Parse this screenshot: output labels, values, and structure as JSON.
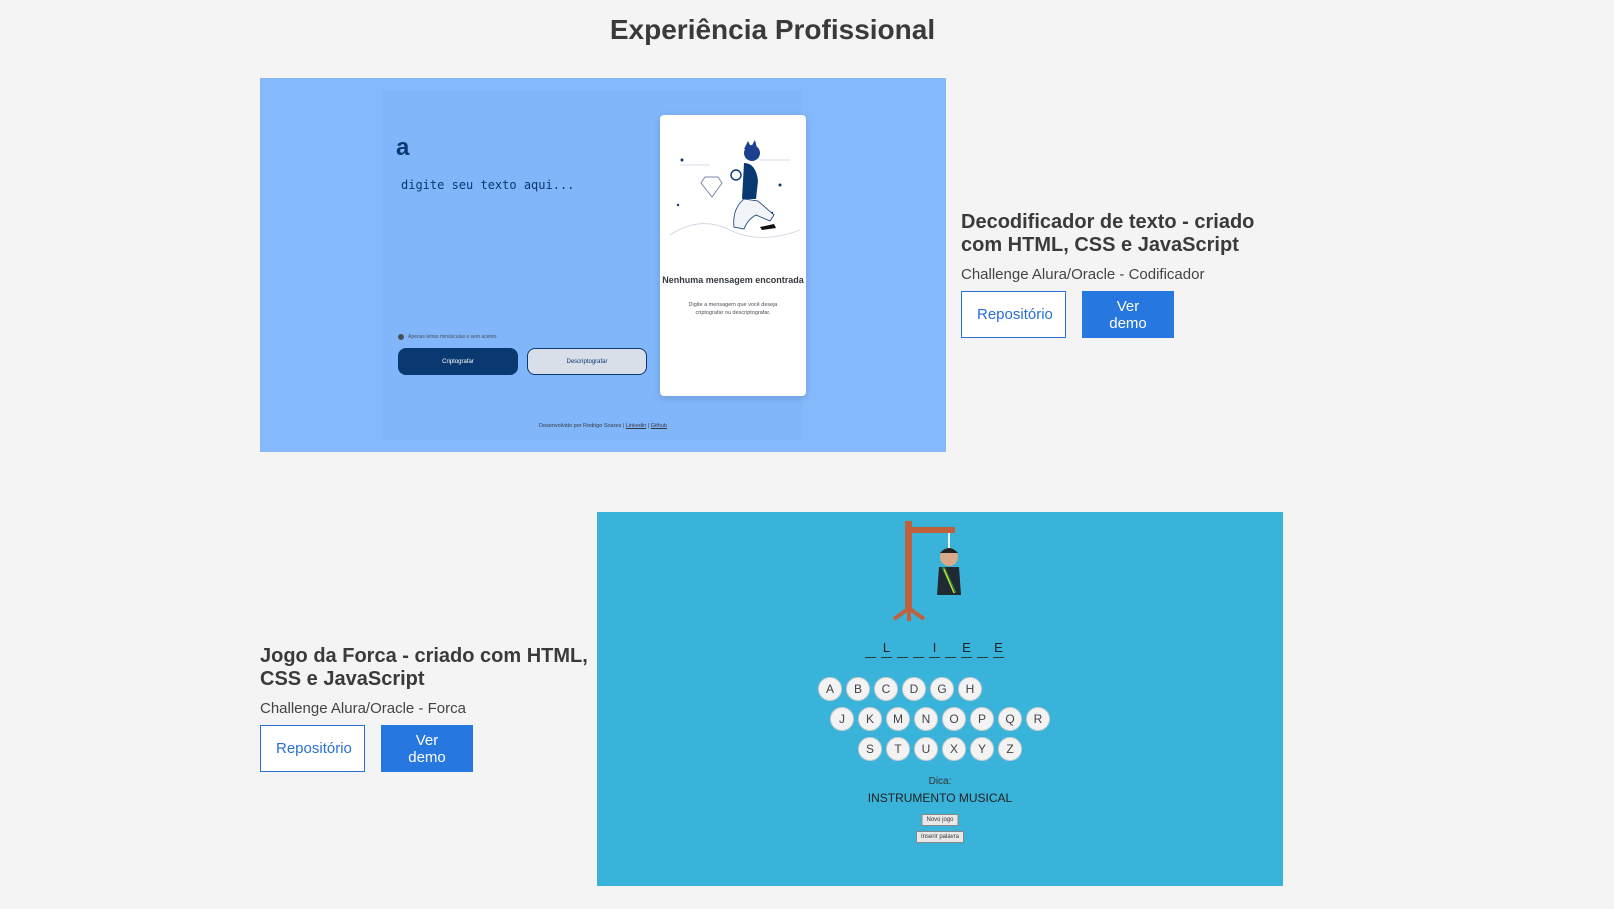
{
  "page": {
    "title": "Experiência Profissional"
  },
  "projects": [
    {
      "title": "Decodificador de texto - criado com HTML, CSS e JavaScript",
      "subtitle": "Challenge Alura/Oracle - Codificador",
      "repo_label": "Repositório",
      "demo_label": "Ver demo",
      "preview": {
        "logo": "a",
        "placeholder": "digite seu texto aqui...",
        "hint": "Apenas letras minúsculas e sem acento.",
        "encrypt_label": "Criptografar",
        "decrypt_label": "Descriptografar",
        "empty_title": "Nenhuma mensagem encontrada",
        "empty_text": "Digite a mensagem que você deseja criptografar ou descriptografar.",
        "footer_text": "Desenvolvido por Rodrigo Soares |",
        "footer_link1": "Linkedin",
        "footer_sep": "|",
        "footer_link2": "Github"
      }
    },
    {
      "title": "Jogo da Forca - criado com HTML, CSS e JavaScript",
      "subtitle": "Challenge Alura/Oracle - Forca",
      "repo_label": "Repositório",
      "demo_label": "Ver demo",
      "preview": {
        "word_slots": [
          "",
          "L",
          "",
          "",
          "I",
          "",
          "E",
          "",
          "E"
        ],
        "key_rows": [
          [
            "A",
            "B",
            "C",
            "D",
            "G",
            "H"
          ],
          [
            "J",
            "K",
            "M",
            "N",
            "O",
            "P",
            "Q",
            "R"
          ],
          [
            "S",
            "T",
            "U",
            "X",
            "Y",
            "Z"
          ]
        ],
        "hint_label": "Dica:",
        "hint_value": "INSTRUMENTO MUSICAL",
        "new_game_label": "Novo jogo",
        "insert_word_label": "Inserir palavra"
      }
    }
  ],
  "colors": {
    "background": "#f4f4f4",
    "accent": "#2677e0",
    "decoder_bg": "#86b9fb",
    "decoder_dark": "#0a3871",
    "forca_bg": "#3ab3db",
    "gallows": "#c0603d"
  }
}
